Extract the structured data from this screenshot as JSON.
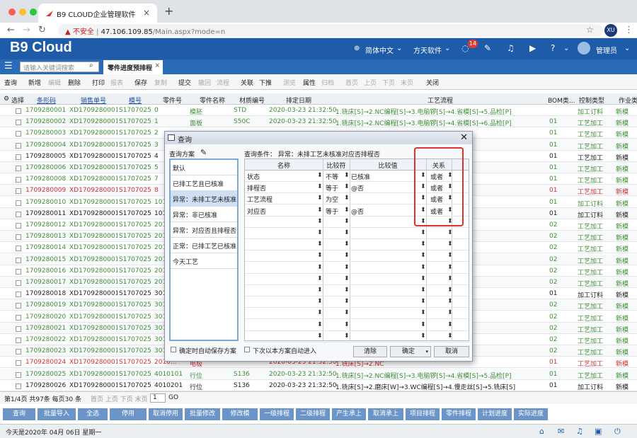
{
  "browser": {
    "tab_title": "B9 CLOUD企业管理软件",
    "insecure": "不安全",
    "url_host": "47.106.109.85",
    "url_path": "/Main.aspx?mode=n",
    "avatar": "XU"
  },
  "header": {
    "brand": "B9 Cloud",
    "lang": "简体中文",
    "company": "方天软件",
    "badge": "14",
    "user": "管理员"
  },
  "search": {
    "placeholder": "请输入关键词搜索"
  },
  "page_tab": "零件进度预排程",
  "toolbar": [
    "查询",
    "新增",
    "编辑",
    "删除",
    "打印",
    "报表",
    "保存",
    "复制",
    "提交",
    "撤回",
    "流程",
    "关联",
    "下推",
    "测览",
    "属性",
    "归档",
    "首页",
    "上页",
    "下页",
    "末页",
    "关闭"
  ],
  "grid": {
    "headers": [
      "选择",
      "条形码",
      "销售单号",
      "模号",
      "零件号",
      "零件名称",
      "材质编号",
      "排定日期",
      "工艺流程",
      "BOM类...",
      "控制类型",
      "作业类"
    ],
    "rows": [
      [
        "1709280001",
        "XD1709280001",
        "S1707025",
        "0",
        "模胚",
        "STD",
        "2020-03-23 21:32:50",
        "1.铣床[S]→2.NC编程[S]→3.电脑锣[S]→4.省模[S]→5.品检[P]",
        "",
        "加工订料",
        "新模"
      ],
      [
        "1709280002",
        "XD1709280001",
        "S1707025",
        "1",
        "面板",
        "S50C",
        "2020-03-23 21:32:50",
        "1.铣床[S]→2.NC编程[S]→3.电脑锣[S]→4.省模[S]→6.品检[P]",
        "01",
        "工艺加工",
        "新模"
      ],
      [
        "1709280003",
        "XD1709280001",
        "S1707025",
        "2",
        "",
        "",
        "",
        "",
        "01",
        "工艺加工",
        "新模"
      ],
      [
        "1709280004",
        "XD1709280001",
        "S1707025",
        "3",
        "",
        "",
        "",
        "电脑锣[S]→7...",
        "01",
        "工艺加工",
        "新模"
      ],
      [
        "1709280005",
        "XD1709280001",
        "S1707025",
        "4",
        "",
        "",
        "",
        "5.铣床[S]",
        "01",
        "工艺加工",
        "新模"
      ],
      [
        "1709280006",
        "XD1709280001",
        "S1707025",
        "5",
        "",
        "",
        "",
        "→6.打火花[S]",
        "01",
        "工艺加工",
        "新模"
      ],
      [
        "1709280008",
        "XD1709280001",
        "S1707025",
        "7",
        "",
        "",
        "",
        "",
        "01",
        "工艺加工",
        "新模"
      ],
      [
        "1709280009",
        "XD1709280001",
        "S1707025",
        "8",
        "",
        "",
        "",
        "",
        "01",
        "工艺加工",
        "新模"
      ],
      [
        "1709280010",
        "XD1709280001",
        "S1707025",
        "101",
        "",
        "",
        "",
        "",
        "01",
        "加工订料",
        "新模"
      ],
      [
        "1709280011",
        "XD1709280001",
        "S1707025",
        "101",
        "",
        "",
        "",
        "",
        "01",
        "加工订料",
        "新模"
      ],
      [
        "1709280012",
        "XD1709280001",
        "S1707025",
        "201",
        "",
        "",
        "",
        "5.铣床[S]→6.车床[S]",
        "02",
        "工艺加工",
        "新模"
      ],
      [
        "1709280013",
        "XD1709280001",
        "S1707025",
        "201",
        "",
        "",
        "",
        "",
        "02",
        "工艺加工",
        "新模"
      ],
      [
        "1709280014",
        "XD1709280001",
        "S1707025",
        "201",
        "",
        "",
        "",
        "",
        "02",
        "工艺加工",
        "新模"
      ],
      [
        "1709280015",
        "XD1709280001",
        "S1707025",
        "201",
        "",
        "",
        "",
        "",
        "02",
        "工艺加工",
        "新模"
      ],
      [
        "1709280016",
        "XD1709280001",
        "S1707025",
        "201",
        "",
        "",
        "",
        "",
        "02",
        "工艺加工",
        "新模"
      ],
      [
        "1709280017",
        "XD1709280001",
        "S1707025",
        "201",
        "",
        "",
        "",
        "",
        "02",
        "工艺加工",
        "新模"
      ],
      [
        "1709280018",
        "XD1709280001",
        "S1707025",
        "301",
        "",
        "",
        "",
        "",
        "01",
        "加工订料",
        "新模"
      ],
      [
        "1709280019",
        "XD1709280001",
        "S1707025",
        "301",
        "",
        "",
        "",
        "",
        "02",
        "工艺加工",
        "新模"
      ],
      [
        "1709280020",
        "XD1709280001",
        "S1707025",
        "301",
        "",
        "",
        "",
        "→6.品检[P]→7...",
        "02",
        "工艺加工",
        "新模"
      ],
      [
        "1709280021",
        "XD1709280001",
        "S1707025",
        "301",
        "",
        "",
        "",
        "慢走丝[S]→6.品...",
        "02",
        "工艺加工",
        "新模"
      ],
      [
        "1709280022",
        "XD1709280001",
        "S1707025",
        "301",
        "",
        "",
        "",
        "",
        "02",
        "工艺加工",
        "新模"
      ],
      [
        "1709280023",
        "XD1709280001",
        "S1707025",
        "301",
        "",
        "",
        "",
        "",
        "02",
        "工艺加工",
        "新模"
      ],
      [
        "1709280024",
        "XD1709280001",
        "S1707025",
        "2010...",
        "电极",
        "",
        "2020-03-23 21:32:50",
        "1.铣床[S]→2.NC",
        "01",
        "工艺加工",
        "新模"
      ],
      [
        "1709280025",
        "XD1709280001",
        "S1707025",
        "4010101",
        "行位",
        "S136",
        "2020-03-23 21:32:50",
        "1.铣床[S]→2.NC编程[S]→3.电脑锣[S]→4.省模[S]→5.品检[P]",
        "01",
        "工艺加工",
        "新模"
      ],
      [
        "1709280026",
        "XD1709280001",
        "S1707025",
        "4010201",
        "行位",
        "S136",
        "2020-03-23 21:32:50",
        "1.铣床[S]→2.磨床[W]→3.WC编程[S]→4.慢走丝[S]→5.铣床[S]",
        "01",
        "加工订料",
        "新模"
      ]
    ]
  },
  "status": {
    "text": "第1/4页 共97条 每页30 条",
    "nav": "首页 上页 下页 末页",
    "page": "1",
    "go": "GO"
  },
  "bottom_buttons": [
    "查询",
    "批量导入",
    "全选",
    "停用",
    "取消停用",
    "批量修改",
    "修改模",
    "一级排程",
    "二级排程",
    "产生承上",
    "取消承上",
    "项目排程",
    "零件排程",
    "计划进度",
    "实际进度"
  ],
  "footer": {
    "date": "今天是2020年 04月 06日 星期一"
  },
  "dialog": {
    "title": "查询",
    "schemes_label": "查询方案",
    "condition_label": "查询条件：  异常：未排工艺未核准对应否排程否",
    "schemes": [
      "默认",
      "已排工艺且已核准",
      "异常：未排工艺未核准...",
      "异常：非已核准",
      "异常：对应否且排程否",
      "正常：已排工艺已核准...",
      "今天工艺"
    ],
    "col_headers": [
      "名称",
      "比较符",
      "比较值",
      "关系"
    ],
    "conditions": [
      {
        "name": "状态",
        "op": "不等",
        "val": "已核准",
        "rel": "或者"
      },
      {
        "name": "排程否",
        "op": "等于",
        "val": "@否",
        "rel": "或者"
      },
      {
        "name": "工艺流程",
        "op": "为空",
        "val": "",
        "rel": "或者"
      },
      {
        "name": "对应否",
        "op": "等于",
        "val": "@否",
        "rel": "或者"
      }
    ],
    "auto_save": "确定时自动保存方案",
    "auto_enter": "下次以本方案自动进入",
    "btn_clear": "清除",
    "btn_ok": "确定",
    "btn_cancel": "取消"
  }
}
